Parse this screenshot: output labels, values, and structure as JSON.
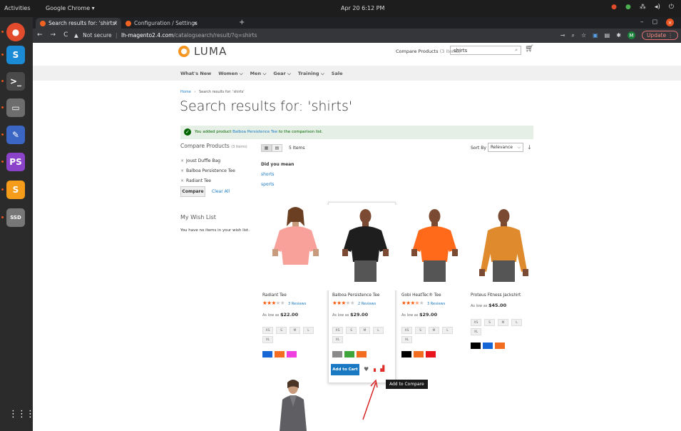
{
  "os": {
    "activities": "Activities",
    "app_menu": "Google Chrome ▾",
    "clock": "Apr 20  6:12 PM",
    "tray_icons": [
      "chrome-icon",
      "green-app-icon",
      "network-icon",
      "volume-icon",
      "power-icon"
    ]
  },
  "dock": {
    "items": [
      {
        "name": "chrome",
        "glyph": "●",
        "color": "#e34b2d"
      },
      {
        "name": "skype",
        "glyph": "S",
        "color": "#1b8bd6"
      },
      {
        "name": "terminal",
        "glyph": ">_",
        "color": "#4a4a4a"
      },
      {
        "name": "files",
        "glyph": "▭",
        "color": "#6d6d6d"
      },
      {
        "name": "text-editor",
        "glyph": "✎",
        "color": "#3b66c4"
      },
      {
        "name": "phpstorm",
        "glyph": "PS",
        "color": "#8a43c9"
      },
      {
        "name": "sublime",
        "glyph": "S",
        "color": "#f59c1a"
      },
      {
        "name": "ssd",
        "glyph": "SSD",
        "color": "#777777"
      }
    ],
    "apps_grid": "⋮⋮⋮"
  },
  "browser": {
    "tabs": [
      {
        "label": "Search results for: 'shirts'",
        "active": true
      },
      {
        "label": "Configuration / Settings",
        "active": false
      }
    ],
    "security": "Not secure",
    "url_host": "lh-magento2.4.com",
    "url_path": "/catalogsearch/result/?q=shirts",
    "profile_initial": "M",
    "update_label": "Update"
  },
  "header": {
    "logo_text": "LUMA",
    "compare_label": "Compare Products",
    "compare_count": "(3 items)",
    "search_value": "shirts"
  },
  "nav": {
    "items": [
      "What's New",
      "Women ⌵",
      "Men ⌵",
      "Gear ⌵",
      "Training ⌵",
      "Sale"
    ]
  },
  "breadcrumbs": {
    "home": "Home",
    "separator": "›",
    "current": "Search results for: 'shirts'"
  },
  "title": "Search results for: 'shirts'",
  "message": {
    "text_before": "You added product ",
    "link": "Balboa Persistence Tee",
    "text_after": " to the comparison list."
  },
  "sidebar": {
    "compare_title": "Compare Products",
    "compare_count": "(3 items)",
    "compare_items": [
      "Joust Duffle Bag",
      "Balboa Persistence Tee",
      "Radiant Tee"
    ],
    "compare_button": "Compare",
    "clear_all": "Clear All",
    "wish_title": "My Wish List",
    "wish_empty": "You have no items in your wish list."
  },
  "toolbar": {
    "amount": "5 Items",
    "sort_label": "Sort By",
    "sort_value": "Relevance",
    "dym_title": "Did you mean",
    "suggestions": [
      "shorts",
      "sports"
    ]
  },
  "products": [
    {
      "name": "Radiant Tee",
      "rating": 3,
      "reviews": "3  Reviews",
      "price_label": "As low as",
      "price": "$22.00",
      "sizes": [
        "XS",
        "S",
        "M",
        "L",
        "XL"
      ],
      "shirt_color": "#f7a19a",
      "skin": "#c99b7d",
      "swatches": [
        "#1766d6",
        "#f26d1f",
        "#ef3fe0"
      ]
    },
    {
      "name": "Balboa Persistence Tee",
      "rating": 3,
      "reviews": "2  Reviews",
      "price_label": "As low as",
      "price": "$29.00",
      "sizes": [
        "XS",
        "S",
        "M",
        "L",
        "XL"
      ],
      "shirt_color": "#1e1e1e",
      "skin": "#7a4a33",
      "swatches": [
        "#8a8a8a",
        "#3da539",
        "#f26d1f"
      ]
    },
    {
      "name": "Gobi HeatTec® Tee",
      "rating": 3.5,
      "reviews": "3  Reviews",
      "price_label": "As low as",
      "price": "$29.00",
      "sizes": [
        "XS",
        "S",
        "M",
        "L",
        "XL"
      ],
      "shirt_color": "#ff6a1a",
      "skin": "#7a4a33",
      "swatches": [
        "#000000",
        "#f26d1f",
        "#e8141e"
      ]
    },
    {
      "name": "Proteus Fitness Jackshirt",
      "rating": 0,
      "reviews": "",
      "price_label": "As low as",
      "price": "$45.00",
      "sizes": [
        "XS",
        "S",
        "M",
        "L",
        "XL"
      ],
      "shirt_color": "#e08a2e",
      "skin": "#7a4a33",
      "swatches": [
        "#000000",
        "#1766d6",
        "#f26d1f"
      ]
    }
  ],
  "hover_actions": {
    "add_to_cart": "Add to Cart",
    "tooltip": "Add to Compare"
  },
  "colors": {
    "accent": "#1979c3",
    "compare_red": "#e02b27",
    "success_bg": "#e5efe5"
  }
}
